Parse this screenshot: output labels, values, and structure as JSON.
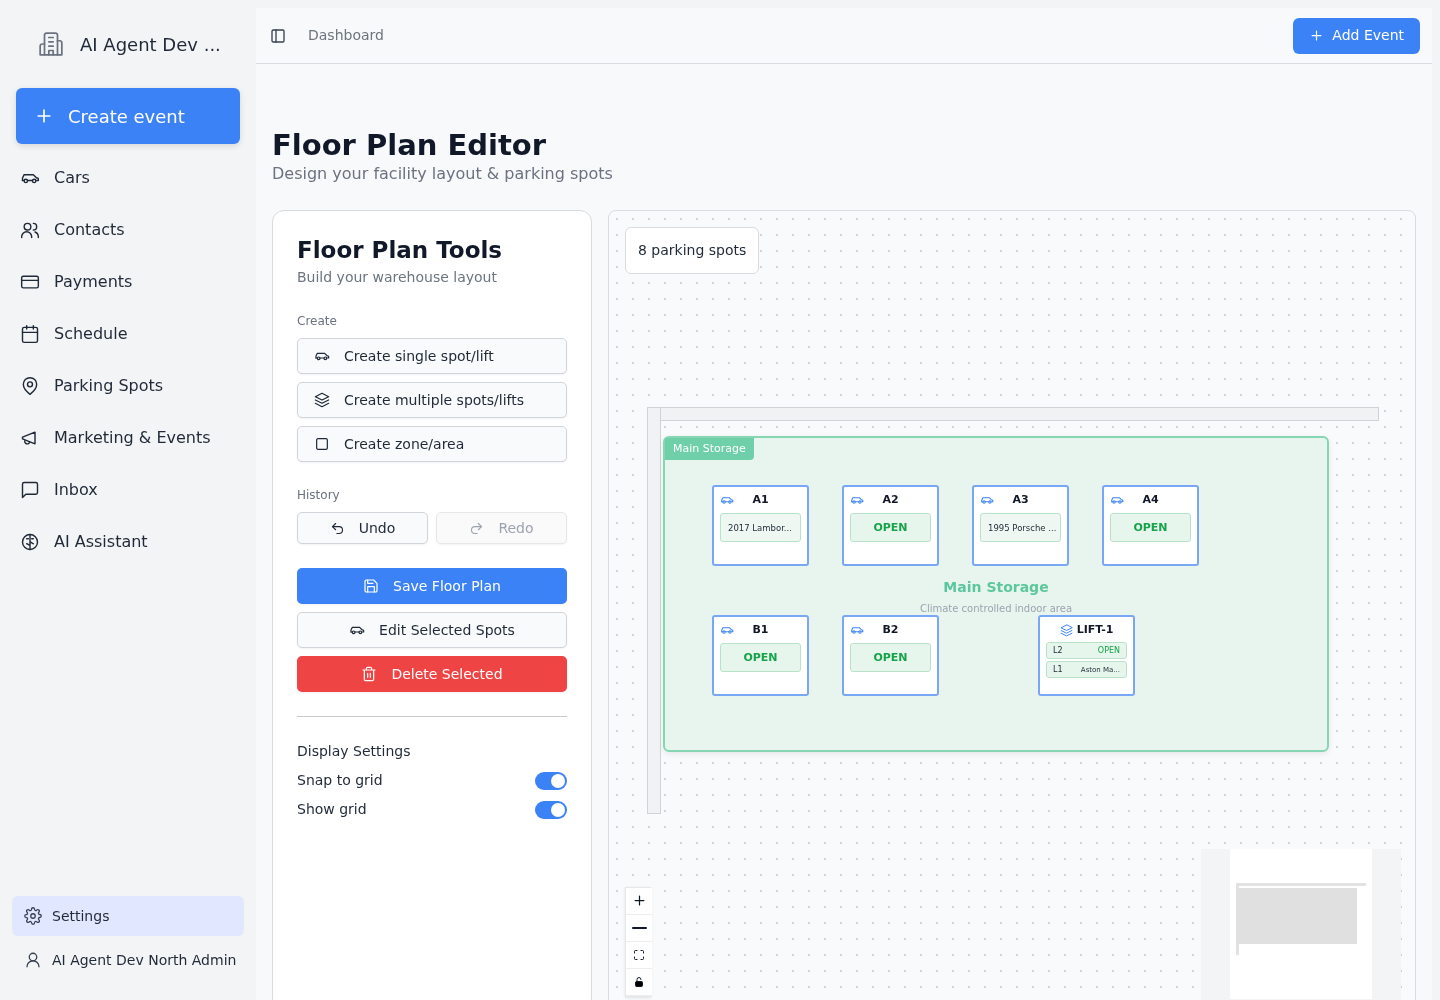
{
  "sidebar": {
    "org_name": "AI Agent Dev ...",
    "create_button": "Create event",
    "items": [
      {
        "label": "Cars",
        "selected": false
      },
      {
        "label": "Contacts",
        "selected": false
      },
      {
        "label": "Payments",
        "selected": false
      },
      {
        "label": "Schedule",
        "selected": false
      },
      {
        "label": "Parking Spots",
        "selected": false
      },
      {
        "label": "Marketing & Events",
        "selected": false
      },
      {
        "label": "Inbox",
        "selected": false
      },
      {
        "label": "AI Assistant",
        "selected": false
      }
    ],
    "footer": [
      {
        "label": "Settings",
        "selected": true
      },
      {
        "label": "AI Agent Dev North Admin",
        "selected": false
      }
    ]
  },
  "header": {
    "breadcrumb": "Dashboard",
    "action_button": "Add Event"
  },
  "page": {
    "title": "Floor Plan Editor",
    "subtitle": "Design your facility layout & parking spots"
  },
  "tools": {
    "title": "Floor Plan Tools",
    "subtitle": "Build your warehouse layout",
    "create_label": "Create",
    "create_buttons": [
      "Create single spot/lift",
      "Create multiple spots/lifts",
      "Create zone/area"
    ],
    "history_label": "History",
    "history_buttons": [
      {
        "label": "Undo",
        "disabled": false
      },
      {
        "label": "Redo",
        "disabled": true
      }
    ],
    "actions": [
      {
        "label": "Save Floor Plan",
        "kind": "primary"
      },
      {
        "label": "Edit Selected Spots",
        "kind": "outline"
      },
      {
        "label": "Delete Selected",
        "kind": "danger"
      }
    ],
    "display_label": "Display Settings",
    "toggles": [
      {
        "label": "Snap to grid",
        "on": true
      },
      {
        "label": "Show grid",
        "on": true
      }
    ]
  },
  "canvas": {
    "spot_count": "8 parking spots",
    "zone": {
      "tag": "Main Storage",
      "title": "Main Storage",
      "description": "Climate controlled indoor area",
      "spots": [
        {
          "kind": "spot",
          "name": "A1",
          "text": "2017 Lambor...",
          "occupied": true
        },
        {
          "kind": "spot",
          "name": "A2",
          "text": "OPEN",
          "occupied": false
        },
        {
          "kind": "spot",
          "name": "A3",
          "text": "1995 Porsche ...",
          "occupied": true
        },
        {
          "kind": "spot",
          "name": "A4",
          "text": "OPEN",
          "occupied": false
        },
        {
          "kind": "spot",
          "name": "B1",
          "text": "OPEN",
          "occupied": false
        },
        {
          "kind": "spot",
          "name": "B2",
          "text": "OPEN",
          "occupied": false
        },
        {
          "kind": "lift",
          "name": "LIFT-1",
          "levels": [
            {
              "level": "L2",
              "text": "OPEN",
              "occupied": false
            },
            {
              "level": "L1",
              "text": "Aston Ma...",
              "occupied": true
            }
          ]
        }
      ]
    }
  }
}
